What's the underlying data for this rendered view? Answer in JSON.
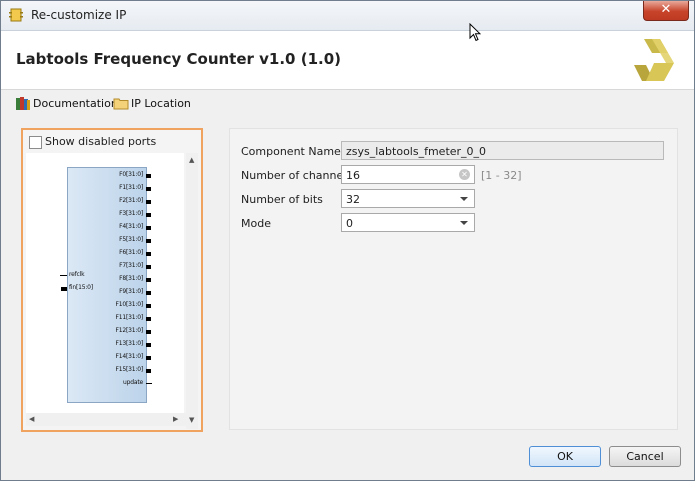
{
  "window": {
    "title": "Re-customize IP",
    "close_glyph": "✕"
  },
  "header": {
    "title": "Labtools Frequency Counter v1.0 (1.0)",
    "logo_icon": "xilinx-logo-icon"
  },
  "links": [
    {
      "label": "Documentation",
      "icon": "books-icon"
    },
    {
      "label": "IP Location",
      "icon": "folder-icon"
    }
  ],
  "preview": {
    "show_disabled_ports_label": "Show disabled ports",
    "show_disabled_ports_checked": false,
    "outputs": [
      "F0[31:0]",
      "F1[31:0]",
      "F2[31:0]",
      "F3[31:0]",
      "F4[31:0]",
      "F5[31:0]",
      "F6[31:0]",
      "F7[31:0]",
      "F8[31:0]",
      "F9[31:0]",
      "F10[31:0]",
      "F11[31:0]",
      "F12[31:0]",
      "F13[31:0]",
      "F14[31:0]",
      "F15[31:0]",
      "update"
    ],
    "inputs": [
      "refclk",
      "fin[15:0]"
    ]
  },
  "form": {
    "component_name": {
      "label": "Component Name",
      "value": "zsys_labtools_fmeter_0_0"
    },
    "channels": {
      "label": "Number of channels",
      "value": "16",
      "range": "[1 - 32]"
    },
    "bits": {
      "label": "Number of bits",
      "value": "32"
    },
    "mode": {
      "label": "Mode",
      "value": "0"
    }
  },
  "buttons": {
    "ok": "OK",
    "cancel": "Cancel"
  },
  "colors": {
    "focus_border": "#f0a35e",
    "accent": "#4f8fd6",
    "close": "#c7432a"
  }
}
